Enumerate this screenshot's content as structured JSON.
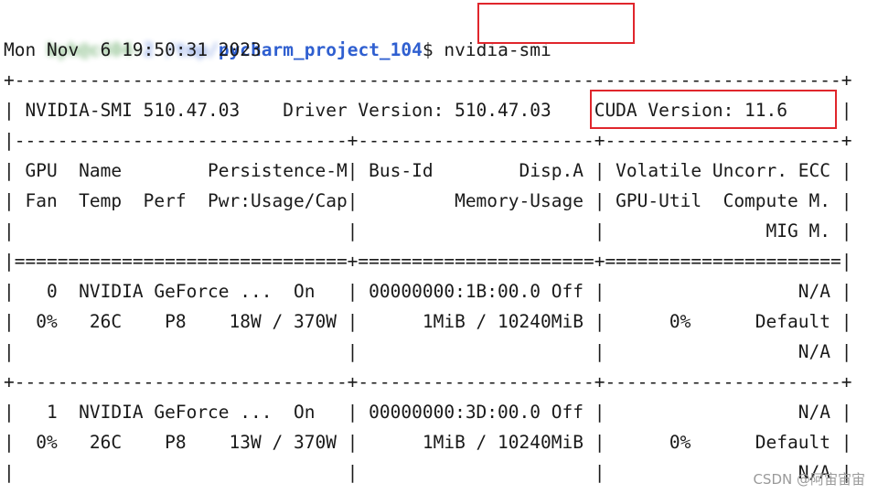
{
  "prompt": {
    "user_host": "byh@c404-",
    "path_obscured": "2 /tmp/",
    "path": "pycharm_project_104",
    "sigil": "$ ",
    "command": "nvidia-smi"
  },
  "timestamp": "Mon Nov  6 19:50:31 2023",
  "table": {
    "border_top": "+-----------------------------------------------------------------------------+",
    "header_line": "| NVIDIA-SMI 510.47.03    Driver Version: 510.47.03    CUDA Version: 11.6     |",
    "separator_cols": "|-------------------------------+----------------------+----------------------+",
    "col_header_1": "| GPU  Name        Persistence-M| Bus-Id        Disp.A | Volatile Uncorr. ECC |",
    "col_header_2": "| Fan  Temp  Perf  Pwr:Usage/Cap|         Memory-Usage | GPU-Util  Compute M. |",
    "col_header_3": "|                               |                      |               MIG M. |",
    "separator_double": "|===============================+======================+======================|",
    "gpu0_line1": "|   0  NVIDIA GeForce ...  On   | 00000000:1B:00.0 Off |                  N/A |",
    "gpu0_line2": "|  0%   26C    P8    18W / 370W |      1MiB / 10240MiB |      0%      Default |",
    "gpu0_line3": "|                               |                      |                  N/A |",
    "separator_gpu": "+-------------------------------+----------------------+----------------------+",
    "gpu1_line1": "|   1  NVIDIA GeForce ...  On   | 00000000:3D:00.0 Off |                  N/A |",
    "gpu1_line2": "|  0%   26C    P8    13W / 370W |      1MiB / 10240MiB |      0%      Default |",
    "gpu1_line3": "|                               |                      |                  N/A |"
  },
  "watermark": "CSDN @阿宙宙宙",
  "colors": {
    "prompt_user": "#2e8b2e",
    "prompt_path": "#2f5fd0",
    "highlight_box": "#e0262c",
    "text": "#1a1a1a"
  }
}
